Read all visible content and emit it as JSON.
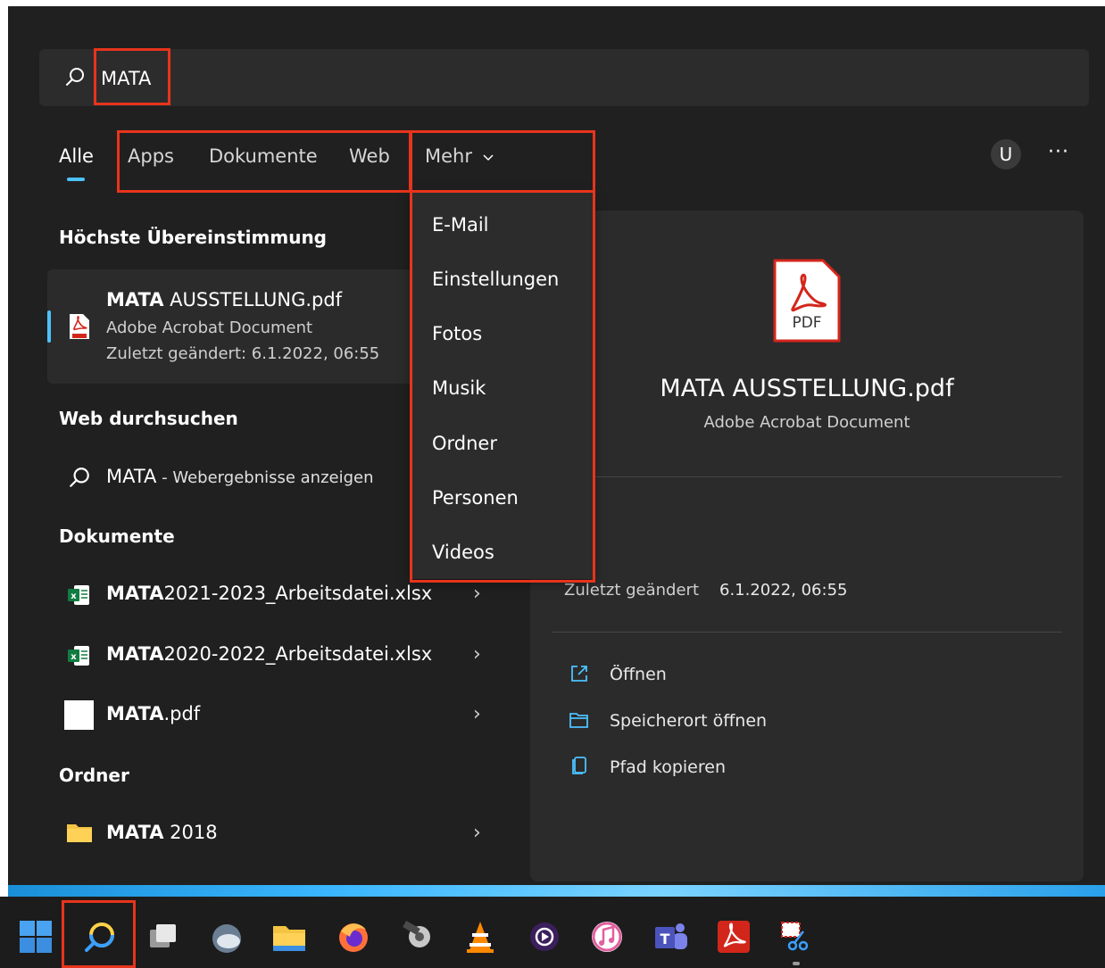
{
  "search": {
    "query": "MATA"
  },
  "tabs": [
    {
      "label": "Alle"
    },
    {
      "label": "Apps"
    },
    {
      "label": "Dokumente"
    },
    {
      "label": "Web"
    },
    {
      "label": "Mehr"
    }
  ],
  "header": {
    "user_initial": "U",
    "more": "···"
  },
  "best_match": {
    "section": "Höchste Übereinstimmung",
    "title_bold": "MATA",
    "title_rest": " AUSSTELLUNG.pdf",
    "type": "Adobe Acrobat Document",
    "modified": "Zuletzt geändert: 6.1.2022, 06:55"
  },
  "web": {
    "section": "Web durchsuchen",
    "query": "MATA",
    "suffix": " - Webergebnisse anzeigen"
  },
  "documents": {
    "section": "Dokumente",
    "items": [
      {
        "bold": "MATA",
        "rest": "2021-2023_Arbeitsdatei.xlsx",
        "icon": "excel-icon"
      },
      {
        "bold": "MATA",
        "rest": "2020-2022_Arbeitsdatei.xlsx",
        "icon": "excel-icon"
      },
      {
        "bold": "MATA",
        "rest": ".pdf",
        "icon": "blank-file-icon"
      }
    ]
  },
  "folders": {
    "section": "Ordner",
    "items": [
      {
        "bold": "MATA",
        "rest": " 2018",
        "icon": "folder-icon"
      }
    ]
  },
  "dropdown": {
    "items": [
      "E-Mail",
      "Einstellungen",
      "Fotos",
      "Musik",
      "Ordner",
      "Personen",
      "Videos"
    ]
  },
  "detail": {
    "file_badge": "PDF",
    "title": "MATA AUSSTELLUNG.pdf",
    "subtitle": "Adobe Acrobat Document",
    "modified_label": "Zuletzt geändert",
    "modified_value": "6.1.2022, 06:55",
    "actions": [
      "Öffnen",
      "Speicherort öffnen",
      "Pfad kopieren"
    ]
  },
  "taskbar": {
    "icons": [
      "windows-start-icon",
      "search-icon",
      "task-view-icon",
      "weather-icon",
      "file-explorer-icon",
      "firefox-icon",
      "video-editor-icon",
      "vlc-icon",
      "media-player-icon",
      "itunes-icon",
      "teams-icon",
      "acrobat-icon",
      "snipping-tool-icon"
    ]
  },
  "colors": {
    "highlight": "#e8341c",
    "accent": "#4cc2ff",
    "panel": "#202020"
  }
}
